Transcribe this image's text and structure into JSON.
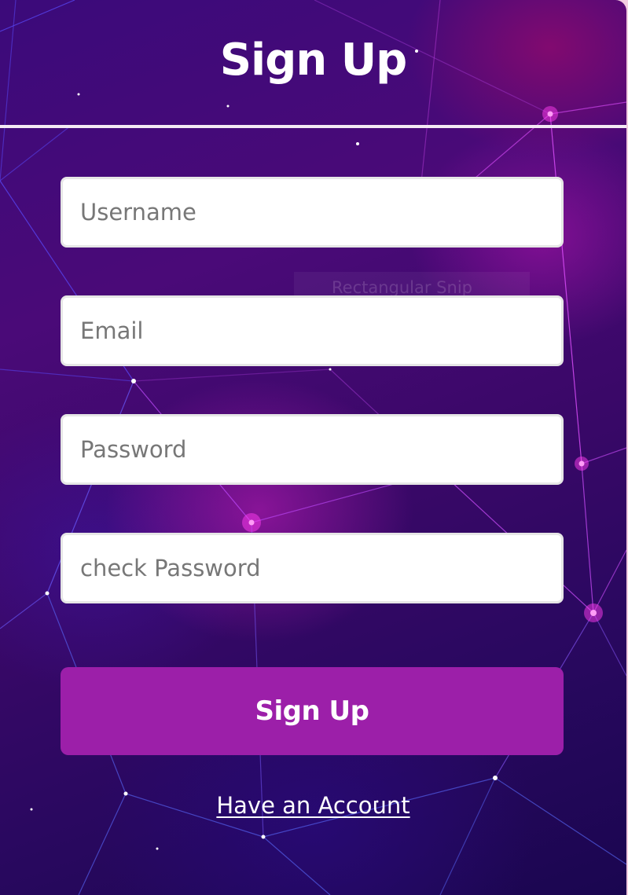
{
  "form": {
    "title": "Sign Up",
    "fields": [
      {
        "name": "username",
        "placeholder": "Username",
        "value": ""
      },
      {
        "name": "email",
        "placeholder": "Email",
        "value": ""
      },
      {
        "name": "password",
        "placeholder": "Password",
        "value": ""
      },
      {
        "name": "check_password",
        "placeholder": "check Password",
        "value": ""
      }
    ],
    "submit_label": "Sign Up",
    "account_link": "Have an Account"
  },
  "overlay": {
    "snip_ghost_text": "Rectangular Snip"
  },
  "colors": {
    "button": "#9c1fa9",
    "background_dark": "#2a0860",
    "background_accent": "#c21ec8"
  }
}
